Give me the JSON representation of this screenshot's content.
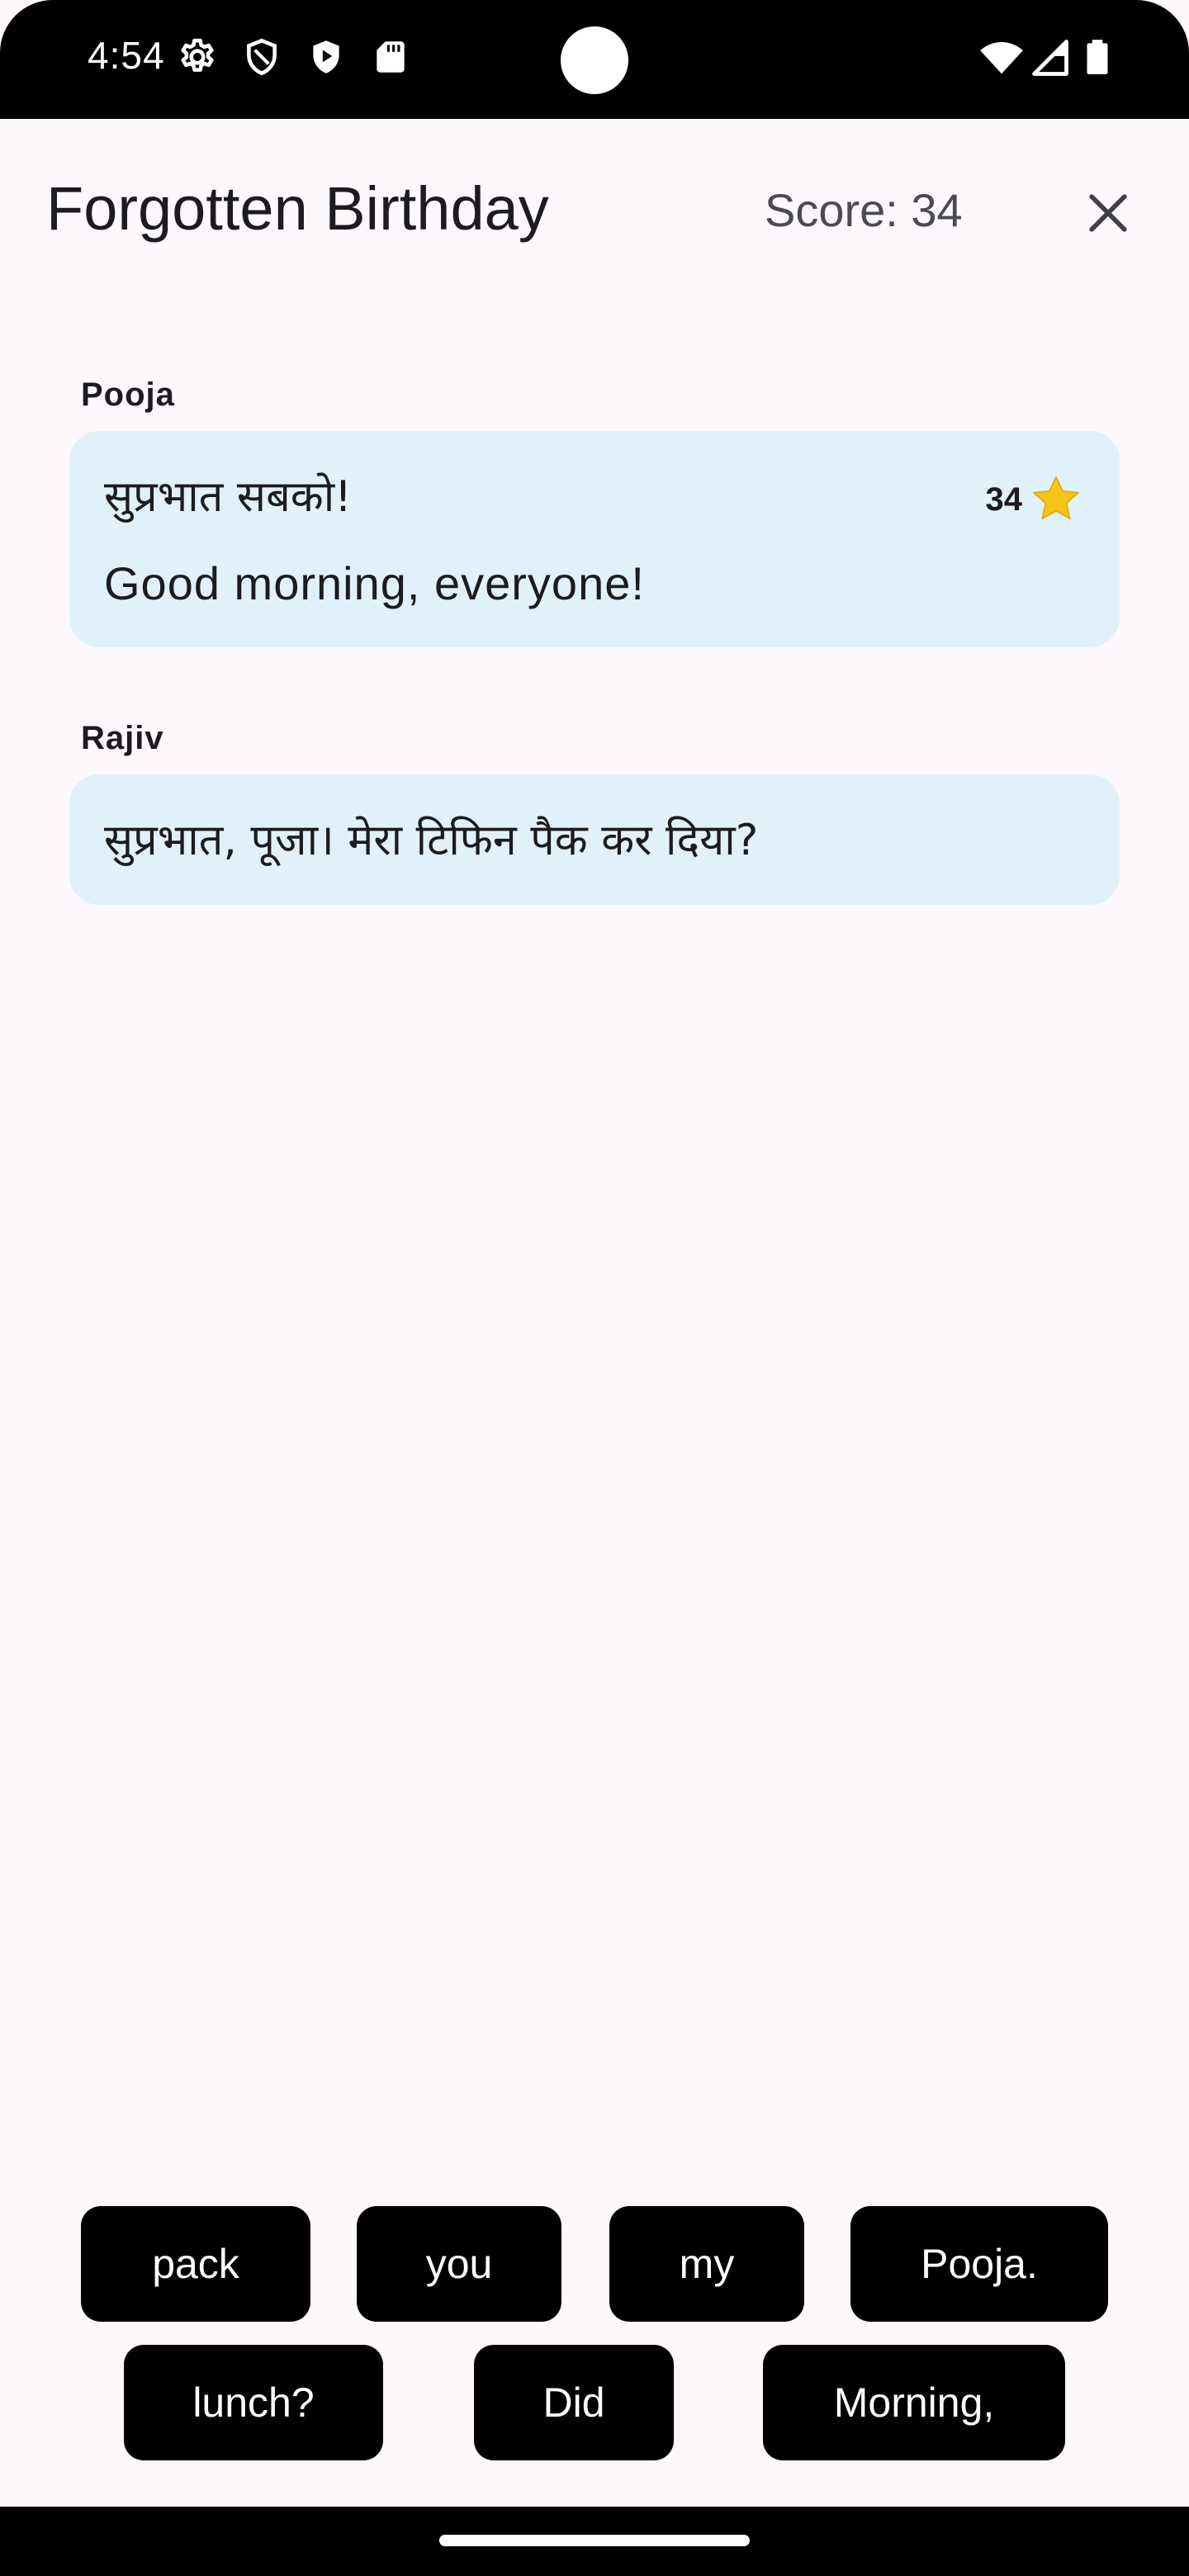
{
  "status_bar": {
    "time": "4:54",
    "icons": [
      "gear-icon",
      "shield-outline-icon",
      "play-shield-icon",
      "sd-card-icon",
      "wifi-icon",
      "signal-icon",
      "battery-icon"
    ]
  },
  "header": {
    "title": "Forgotten Birthday",
    "score": "Score: 34",
    "close_icon": "close-icon"
  },
  "messages": [
    {
      "speaker": "Pooja",
      "text": "सुप्रभात सबको!",
      "translation": "Good morning, everyone!",
      "points": "34",
      "points_icon": "star-icon"
    },
    {
      "speaker": "Rajiv",
      "text": "सुप्रभात, पूजा। मेरा टिफिन पैक कर दिया?"
    }
  ],
  "word_chips": [
    "pack",
    "you",
    "my",
    "Pooja.",
    "lunch?",
    "Did",
    "Morning,"
  ],
  "colors": {
    "background": "#fdf8fc",
    "bubble": "#e1f1fb",
    "chip": "#000000",
    "star": "#f5c518"
  }
}
